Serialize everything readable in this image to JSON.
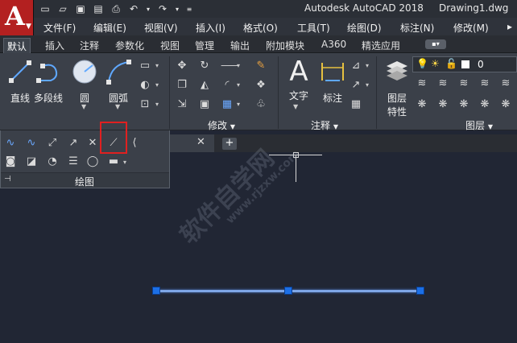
{
  "app": {
    "logo_letter": "A",
    "title": "Autodesk AutoCAD 2018",
    "document": "Drawing1.dwg"
  },
  "menu": [
    "文件(F)",
    "编辑(E)",
    "视图(V)",
    "插入(I)",
    "格式(O)",
    "工具(T)",
    "绘图(D)",
    "标注(N)",
    "修改(M)"
  ],
  "tabs": [
    "默认",
    "插入",
    "注释",
    "参数化",
    "视图",
    "管理",
    "输出",
    "附加模块",
    "A360",
    "精选应用"
  ],
  "ribbon": {
    "draw_tools": [
      "直线",
      "多段线",
      "圆",
      "圆弧"
    ],
    "modify_title": "修改",
    "annotate_tools": [
      "文字",
      "标注"
    ],
    "annotate_title": "注释",
    "layer_tool_line1": "图层",
    "layer_tool_line2": "特性",
    "layer_title": "图层",
    "layer_current": "0",
    "draw_title": "绘图"
  },
  "watermark": {
    "main": "软件自学网",
    "sub": "www.rjzxw.com"
  },
  "colors": {
    "accent_red": "#e02020",
    "grip_blue": "#1c6fe6",
    "app_red": "#b32020"
  }
}
